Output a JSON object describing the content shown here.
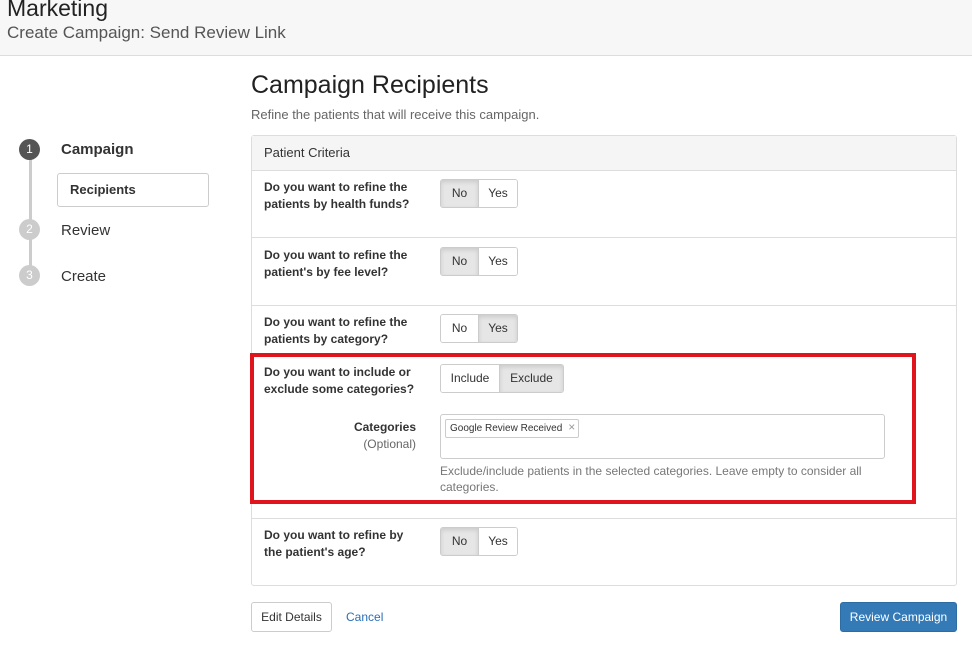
{
  "header": {
    "title": "Marketing",
    "subtitle": "Create Campaign: Send Review Link"
  },
  "stepper": {
    "steps": [
      {
        "number": "1",
        "label": "Campaign"
      },
      {
        "number": "2",
        "label": "Review"
      },
      {
        "number": "3",
        "label": "Create"
      }
    ],
    "active_substep": "Recipients"
  },
  "main": {
    "title": "Campaign Recipients",
    "subtitle": "Refine the patients that will receive this campaign.",
    "panel_heading": "Patient Criteria",
    "criteria": [
      {
        "question": "Do you want to refine the patients by health funds?",
        "options": [
          "No",
          "Yes"
        ],
        "selected": "No"
      },
      {
        "question": "Do you want to refine the patient's by fee level?",
        "options": [
          "No",
          "Yes"
        ],
        "selected": "No"
      },
      {
        "question": "Do you want to refine the patients by category?",
        "options": [
          "No",
          "Yes"
        ],
        "selected": "Yes"
      },
      {
        "question": "Do you want to include or exclude some categories?",
        "options": [
          "Include",
          "Exclude"
        ],
        "selected": "Exclude"
      },
      {
        "question": "Do you want to refine by the patient's age?",
        "options": [
          "No",
          "Yes"
        ],
        "selected": "No"
      }
    ],
    "categories": {
      "label": "Categories",
      "optional": "(Optional)",
      "selected_tags": [
        "Google Review Received"
      ],
      "help": "Exclude/include patients in the selected categories. Leave empty to consider all categories."
    }
  },
  "footer": {
    "edit_label": "Edit Details",
    "cancel_label": "Cancel",
    "review_label": "Review Campaign"
  },
  "colors": {
    "primary": "#337ab7",
    "highlight": "#e0141d"
  }
}
